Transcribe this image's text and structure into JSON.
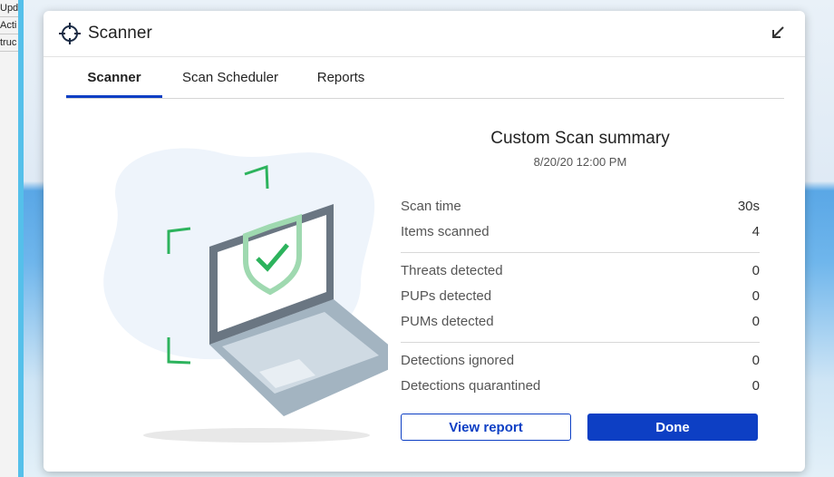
{
  "background": {
    "left_strip_lines": [
      "Upd",
      "Acti",
      "truc"
    ]
  },
  "window": {
    "title": "Scanner",
    "title_icon": "crosshair-icon",
    "minimize_icon": "arrow-down-left-icon"
  },
  "tabs": [
    {
      "label": "Scanner",
      "active": true
    },
    {
      "label": "Scan Scheduler",
      "active": false
    },
    {
      "label": "Reports",
      "active": false
    }
  ],
  "summary": {
    "title": "Custom Scan summary",
    "date": "8/20/20 12:00 PM",
    "group1": [
      {
        "label": "Scan time",
        "value": "30s"
      },
      {
        "label": "Items scanned",
        "value": "4"
      }
    ],
    "group2": [
      {
        "label": "Threats detected",
        "value": "0"
      },
      {
        "label": "PUPs detected",
        "value": "0"
      },
      {
        "label": "PUMs detected",
        "value": "0"
      }
    ],
    "group3": [
      {
        "label": "Detections ignored",
        "value": "0"
      },
      {
        "label": "Detections quarantined",
        "value": "0"
      }
    ]
  },
  "buttons": {
    "view_report": "View report",
    "done": "Done"
  },
  "colors": {
    "accent": "#0d3fc4",
    "shield_green": "#2db35d"
  }
}
